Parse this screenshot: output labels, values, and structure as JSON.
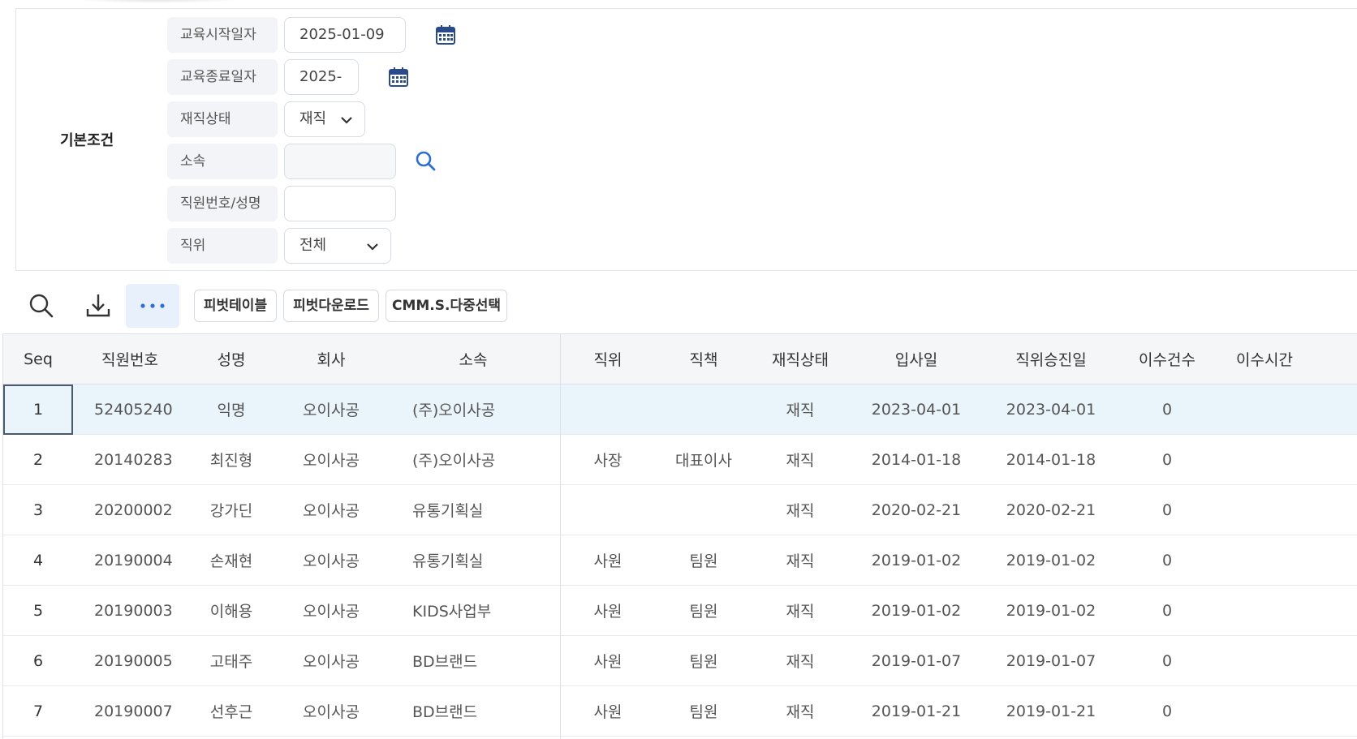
{
  "filters": {
    "group_title": "기본조건",
    "start_date": {
      "label": "교육시작일자",
      "value": "2025-01-09"
    },
    "end_date": {
      "label": "교육종료일자",
      "value": "2025-"
    },
    "status": {
      "label": "재직상태",
      "value": "재직"
    },
    "affiliation": {
      "label": "소속",
      "value": ""
    },
    "employee": {
      "label": "직원번호/성명",
      "value": ""
    },
    "position": {
      "label": "직위",
      "value": "전체"
    }
  },
  "toolbar": {
    "pivot_table": "피벗테이블",
    "pivot_download": "피벗다운로드",
    "multi_select": "CMM.S.다중선택"
  },
  "grid": {
    "columns": [
      "Seq",
      "직원번호",
      "성명",
      "회사",
      "소속",
      "직위",
      "직책",
      "재직상태",
      "입사일",
      "직위승진일",
      "이수건수",
      "이수시간"
    ],
    "rows": [
      [
        "1",
        "52405240",
        "익명",
        "오이사공",
        "(주)오이사공",
        "",
        "",
        "재직",
        "2023-04-01",
        "2023-04-01",
        "0",
        ""
      ],
      [
        "2",
        "20140283",
        "최진형",
        "오이사공",
        "(주)오이사공",
        "사장",
        "대표이사",
        "재직",
        "2014-01-18",
        "2014-01-18",
        "0",
        ""
      ],
      [
        "3",
        "20200002",
        "강가딘",
        "오이사공",
        "유통기획실",
        "",
        "",
        "재직",
        "2020-02-21",
        "2020-02-21",
        "0",
        ""
      ],
      [
        "4",
        "20190004",
        "손재현",
        "오이사공",
        "유통기획실",
        "사원",
        "팀원",
        "재직",
        "2019-01-02",
        "2019-01-02",
        "0",
        ""
      ],
      [
        "5",
        "20190003",
        "이해용",
        "오이사공",
        "KIDS사업부",
        "사원",
        "팀원",
        "재직",
        "2019-01-02",
        "2019-01-02",
        "0",
        ""
      ],
      [
        "6",
        "20190005",
        "고태주",
        "오이사공",
        "BD브랜드",
        "사원",
        "팀원",
        "재직",
        "2019-01-07",
        "2019-01-07",
        "0",
        ""
      ],
      [
        "7",
        "20190007",
        "선후근",
        "오이사공",
        "BD브랜드",
        "사원",
        "팀원",
        "재직",
        "2019-01-21",
        "2019-01-21",
        "0",
        ""
      ]
    ]
  },
  "colors": {
    "accent": "#2f6fd1",
    "selected_row": "#eaf4fb",
    "label_bg": "#f2f4f7"
  }
}
